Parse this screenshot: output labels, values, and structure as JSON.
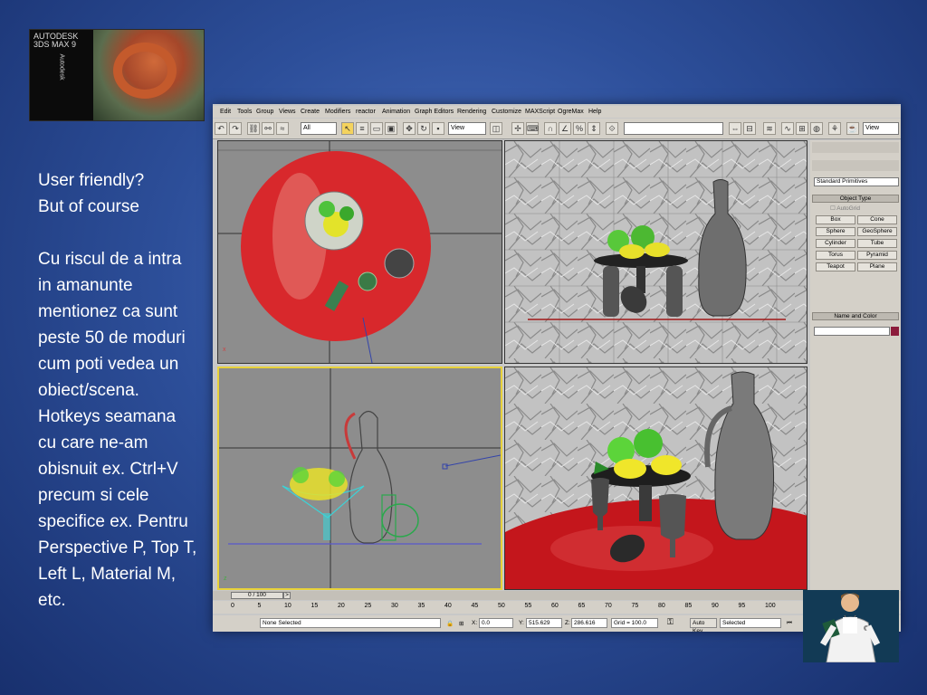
{
  "logo": {
    "brand_lines": "AUTODESK\n3DS MAX 9",
    "vertical_brand": "Autodesk"
  },
  "notes": {
    "lines_a": [
      "User friendly?",
      "But of course"
    ],
    "lines_b": [
      "Cu riscul de a intra",
      "in amanunte",
      "mentionez ca sunt",
      "peste 50 de moduri",
      "cum poti vedea un",
      "obiect/scena.",
      "Hotkeys seamana",
      "cu care ne-am",
      "obisnuit ex. Ctrl+V",
      "precum si cele",
      "specifice ex. Pentru",
      "Perspective P, Top T,",
      "Left L, Material M,",
      "etc."
    ]
  },
  "app": {
    "menu": [
      "Edit",
      "Tools",
      "Group",
      "Views",
      "Create",
      "Modifiers",
      "reactor",
      "Animation",
      "Graph Editors",
      "Rendering",
      "Customize",
      "MAXScript",
      "OgreMax",
      "Help"
    ],
    "toolbar": {
      "selection_filter": "All",
      "reference_coord": "View",
      "named_selection": "",
      "view_dropdown": "View"
    },
    "command_panel": {
      "category": "Standard Primitives",
      "object_type_title": "Object Type",
      "autogrid": "AutoGrid",
      "primitives": [
        "Box",
        "Cone",
        "Sphere",
        "GeoSphere",
        "Cylinder",
        "Tube",
        "Torus",
        "Pyramid",
        "Teapot",
        "Plane"
      ],
      "name_color_title": "Name and Color",
      "minus": "-",
      "swatch_color": "#8c1c3c"
    },
    "timeline": {
      "slider_label": "0 / 100",
      "arrow_right": ">",
      "ruler_ticks": [
        "0",
        "5",
        "10",
        "15",
        "20",
        "25",
        "30",
        "35",
        "40",
        "45",
        "50",
        "55",
        "60",
        "65",
        "70",
        "75",
        "80",
        "85",
        "90",
        "95",
        "100"
      ]
    },
    "status": {
      "selection": "None Selected",
      "x_label": "X:",
      "x_value": "0.0",
      "y_label": "Y:",
      "y_value": "515.629",
      "z_label": "Z:",
      "z_value": "286.616",
      "grid": "Grid = 100.0",
      "auto_key": "Auto Key",
      "key_mode": "Selected"
    }
  }
}
